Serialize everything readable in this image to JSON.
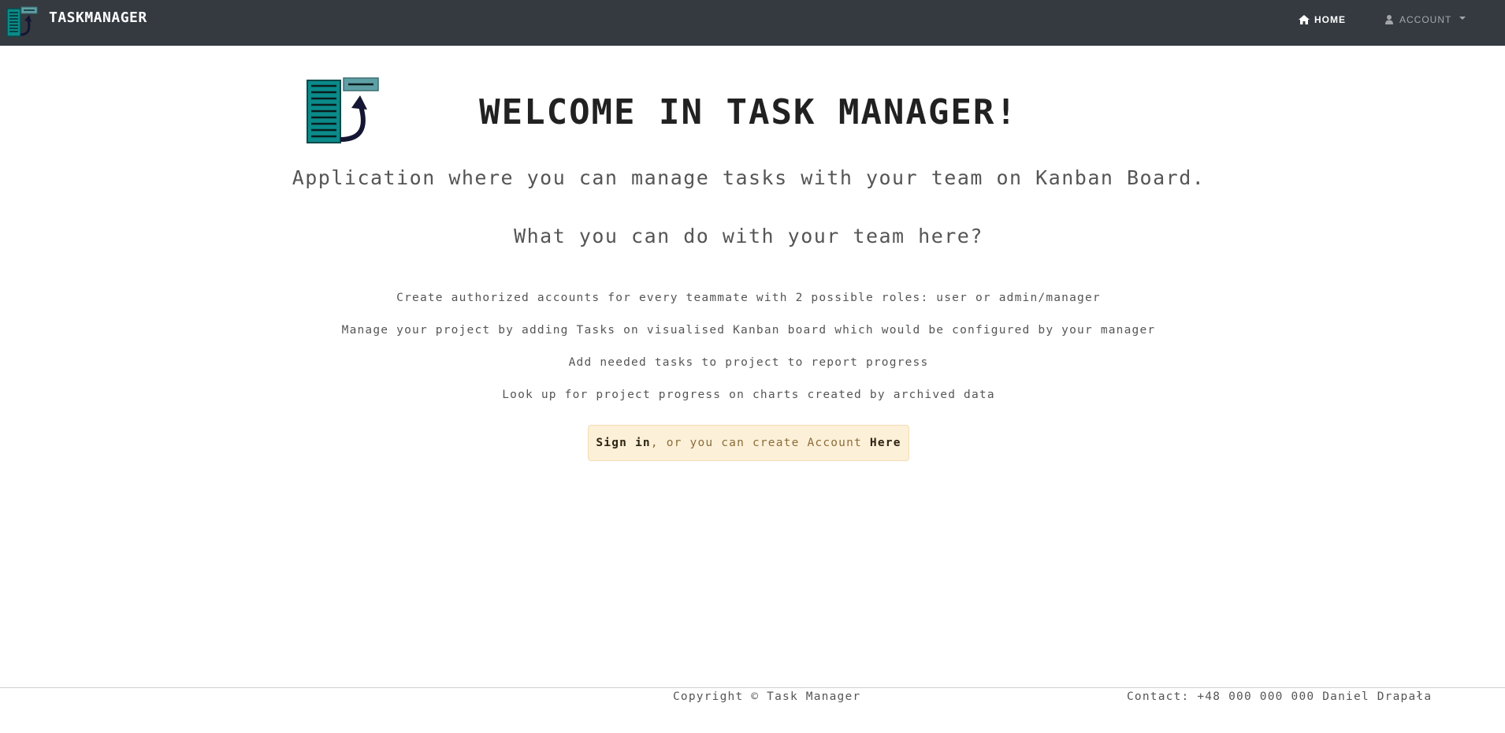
{
  "navbar": {
    "brand": "TASKMANAGER",
    "home_label": "HOME",
    "account_label": "ACCOUNT",
    "home_icon": "home-icon",
    "account_icon": "user-icon",
    "background": "#343a40"
  },
  "hero": {
    "logo_icon": "taskmanager-logo",
    "title": "WELCOME IN TASK MANAGER!",
    "subtitle": "Application where you can manage tasks with your team on Kanban Board.",
    "question": "What you can do with your team here?"
  },
  "features": [
    "Create authorized accounts for every teammate with 2 possible roles: user or admin/manager",
    "Manage your project by adding Tasks on visualised Kanban board which would be configured by your manager",
    "Add needed tasks to project to report progress",
    "Look up for project progress on charts created by archived data"
  ],
  "cta": {
    "signin_label": "Sign in",
    "middle_text": ", or you can create Account ",
    "here_label": "Here",
    "background": "#fdf0d8"
  },
  "footer": {
    "copyright": "Copyright © Task Manager",
    "contact": "Contact: +48 000 000 000 Daniel Drapała"
  }
}
